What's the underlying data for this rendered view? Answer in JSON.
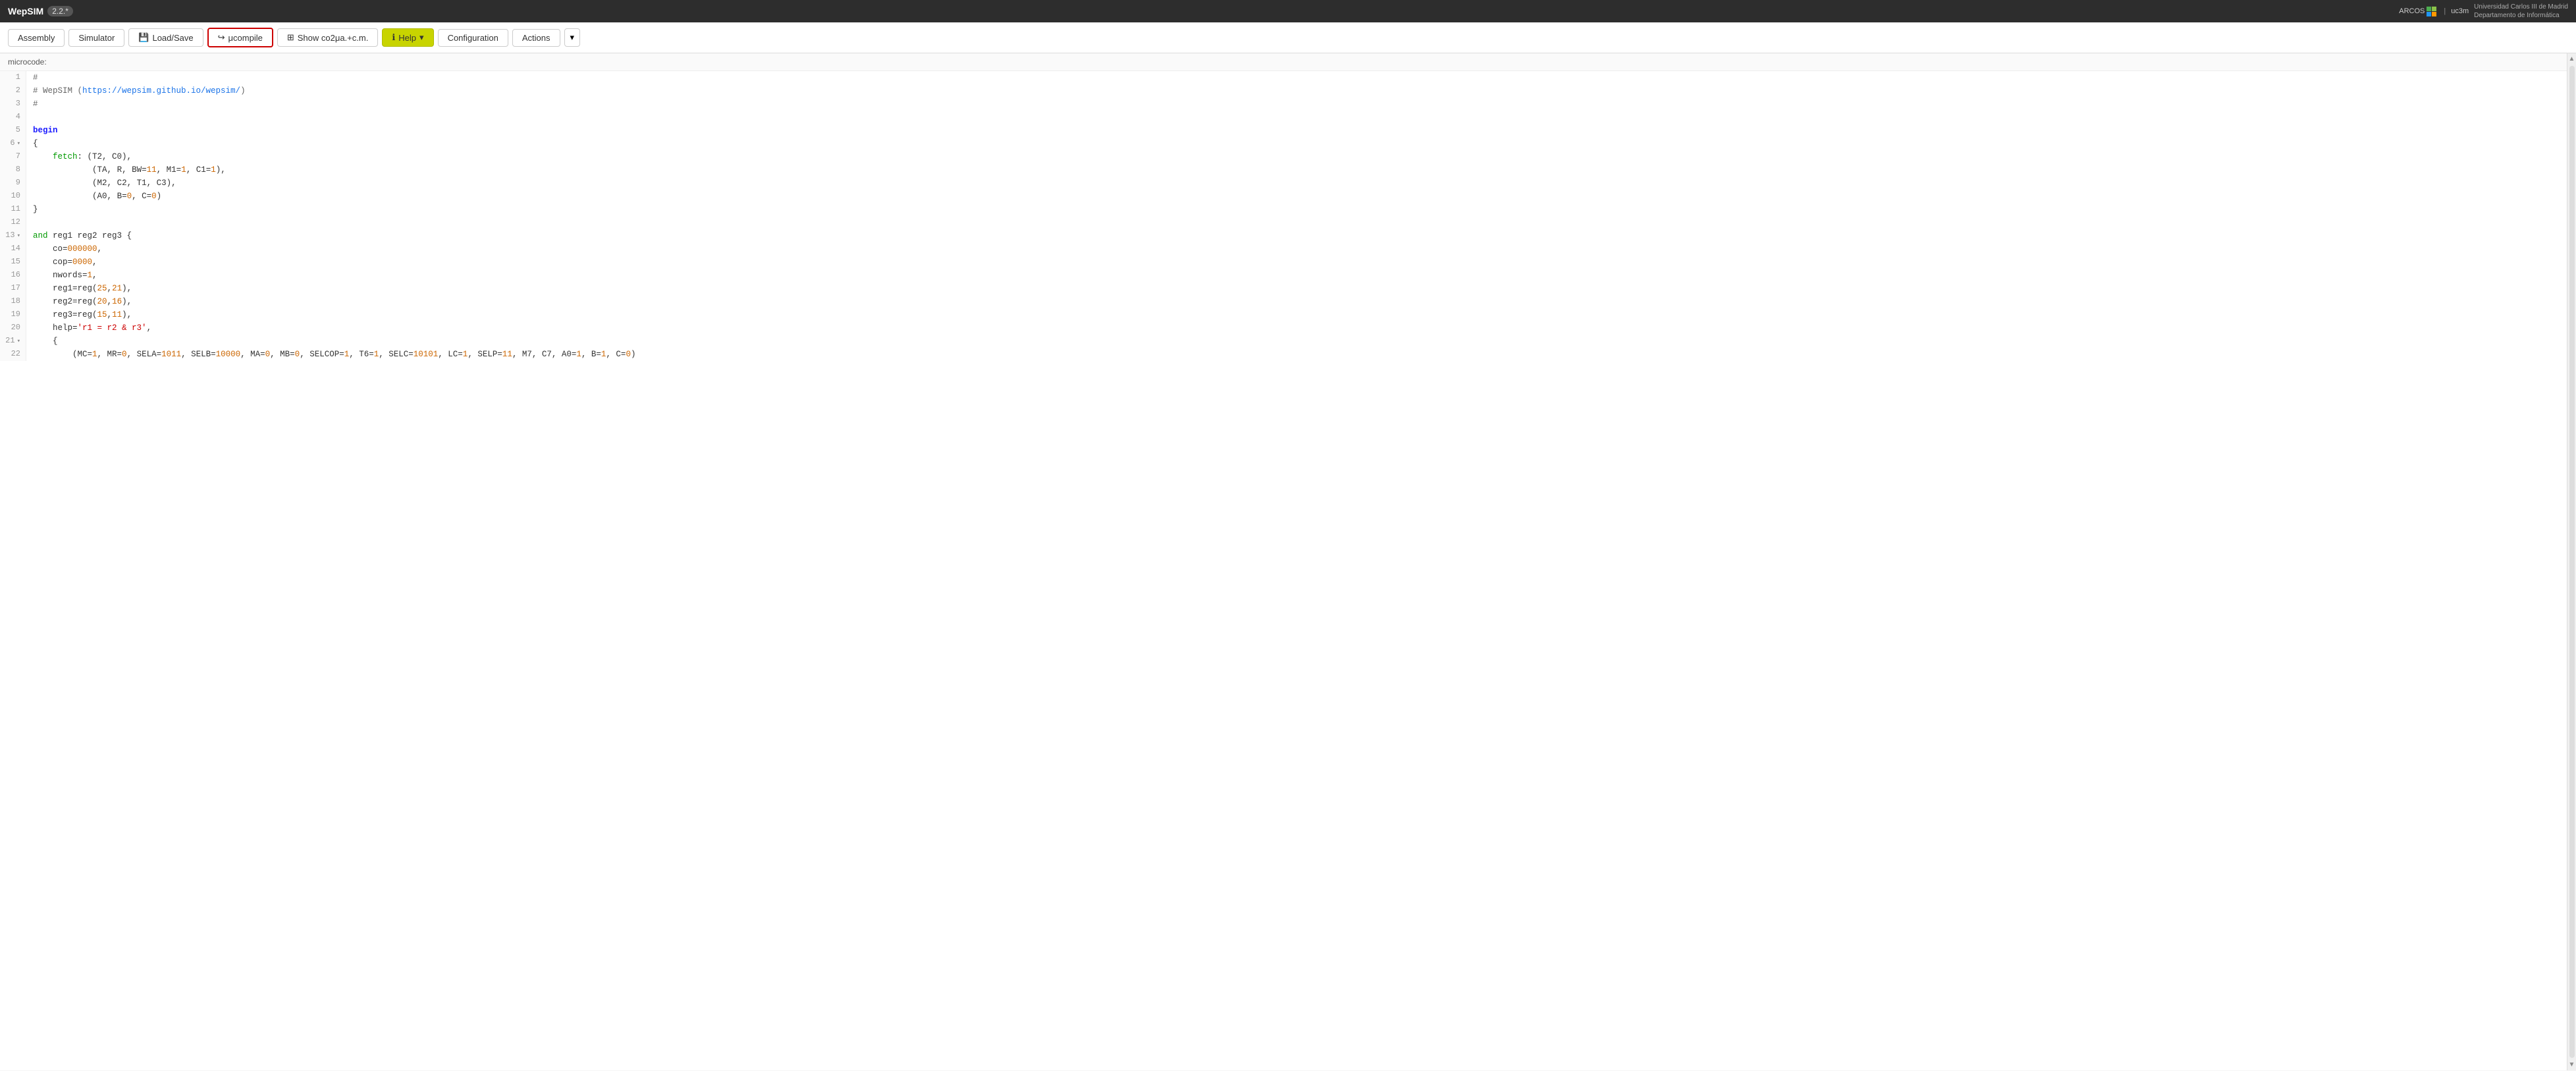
{
  "topbar": {
    "app_name": "WepSIM",
    "version": "2.2.*",
    "arcos_label": "ARCOS",
    "uc3m_label": "uc3m",
    "university": "Universidad Carlos III de Madrid",
    "department": "Departamento de Informática"
  },
  "toolbar": {
    "assembly_label": "Assembly",
    "simulator_label": "Simulator",
    "loadsave_label": "Load/Save",
    "ucompile_label": "μcompile",
    "show_co2_label": "Show co2μa.+c.m.",
    "help_label": "Help",
    "configuration_label": "Configuration",
    "actions_label": "Actions"
  },
  "editor": {
    "microcode_label": "microcode:",
    "lines": [
      {
        "num": 1,
        "fold": false,
        "content": "#",
        "type": "comment"
      },
      {
        "num": 2,
        "fold": false,
        "content": "# WepSIM (https://wepsim.github.io/wepsim/)",
        "type": "comment_link"
      },
      {
        "num": 3,
        "fold": false,
        "content": "#",
        "type": "comment"
      },
      {
        "num": 4,
        "fold": false,
        "content": "",
        "type": "empty"
      },
      {
        "num": 5,
        "fold": false,
        "content": "begin",
        "type": "keyword"
      },
      {
        "num": 6,
        "fold": true,
        "content": "{",
        "type": "brace"
      },
      {
        "num": 7,
        "fold": false,
        "content": "    fetch: (T2, C0),",
        "type": "fetch"
      },
      {
        "num": 8,
        "fold": false,
        "content": "            (TA, R, BW=11, M1=1, C1=1),",
        "type": "fetch_args"
      },
      {
        "num": 9,
        "fold": false,
        "content": "            (M2, C2, T1, C3),",
        "type": "fetch_args"
      },
      {
        "num": 10,
        "fold": false,
        "content": "            (A0, B=0, C=0)",
        "type": "fetch_args"
      },
      {
        "num": 11,
        "fold": false,
        "content": "}",
        "type": "brace"
      },
      {
        "num": 12,
        "fold": false,
        "content": "",
        "type": "empty"
      },
      {
        "num": 13,
        "fold": true,
        "content": "and reg1 reg2 reg3 {",
        "type": "instr"
      },
      {
        "num": 14,
        "fold": false,
        "content": "    co=000000,",
        "type": "field"
      },
      {
        "num": 15,
        "fold": false,
        "content": "    cop=0000,",
        "type": "field"
      },
      {
        "num": 16,
        "fold": false,
        "content": "    nwords=1,",
        "type": "field"
      },
      {
        "num": 17,
        "fold": false,
        "content": "    reg1=reg(25,21),",
        "type": "field"
      },
      {
        "num": 18,
        "fold": false,
        "content": "    reg2=reg(20,16),",
        "type": "field"
      },
      {
        "num": 19,
        "fold": false,
        "content": "    reg3=reg(15,11),",
        "type": "field"
      },
      {
        "num": 20,
        "fold": false,
        "content": "    help='r1 = r2 & r3',",
        "type": "help_field"
      },
      {
        "num": 21,
        "fold": true,
        "content": "    {",
        "type": "brace"
      },
      {
        "num": 22,
        "fold": false,
        "content": "        (MC=1, MR=0, SELA=1011, SELB=10000, MA=0, MB=0, SELCOP=1, T6=1, SELC=10101, LC=1, SELP=11, M7, C7, A0=1, B=1, C=0)",
        "type": "microop"
      }
    ]
  }
}
